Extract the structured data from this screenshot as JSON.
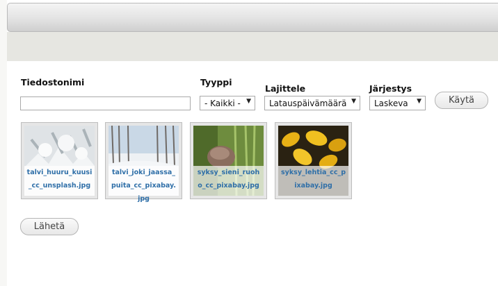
{
  "filters": {
    "filename_label": "Tiedostonimi",
    "filename_value": "",
    "type_label": "Tyyppi",
    "type_selected": "- Kaikki -",
    "sort_label": "Lajittele",
    "sort_selected": "Latauspäivämäärä",
    "order_label": "Järjestys",
    "order_selected": "Laskeva",
    "apply_button": "Käytä"
  },
  "thumbnails": [
    {
      "filename": "talvi_huuru_kuusi_cc_unsplash.jpg"
    },
    {
      "filename": "talvi_joki_jaassa_puita_cc_pixabay.jpg"
    },
    {
      "filename": "syksy_sieni_ruoho_cc_pixabay.jpg"
    },
    {
      "filename": "syksy_lehtia_cc_pixabay.jpg"
    }
  ],
  "submit_button": "Lähetä",
  "icons": {
    "dropdown": "triangle-down-icon"
  }
}
